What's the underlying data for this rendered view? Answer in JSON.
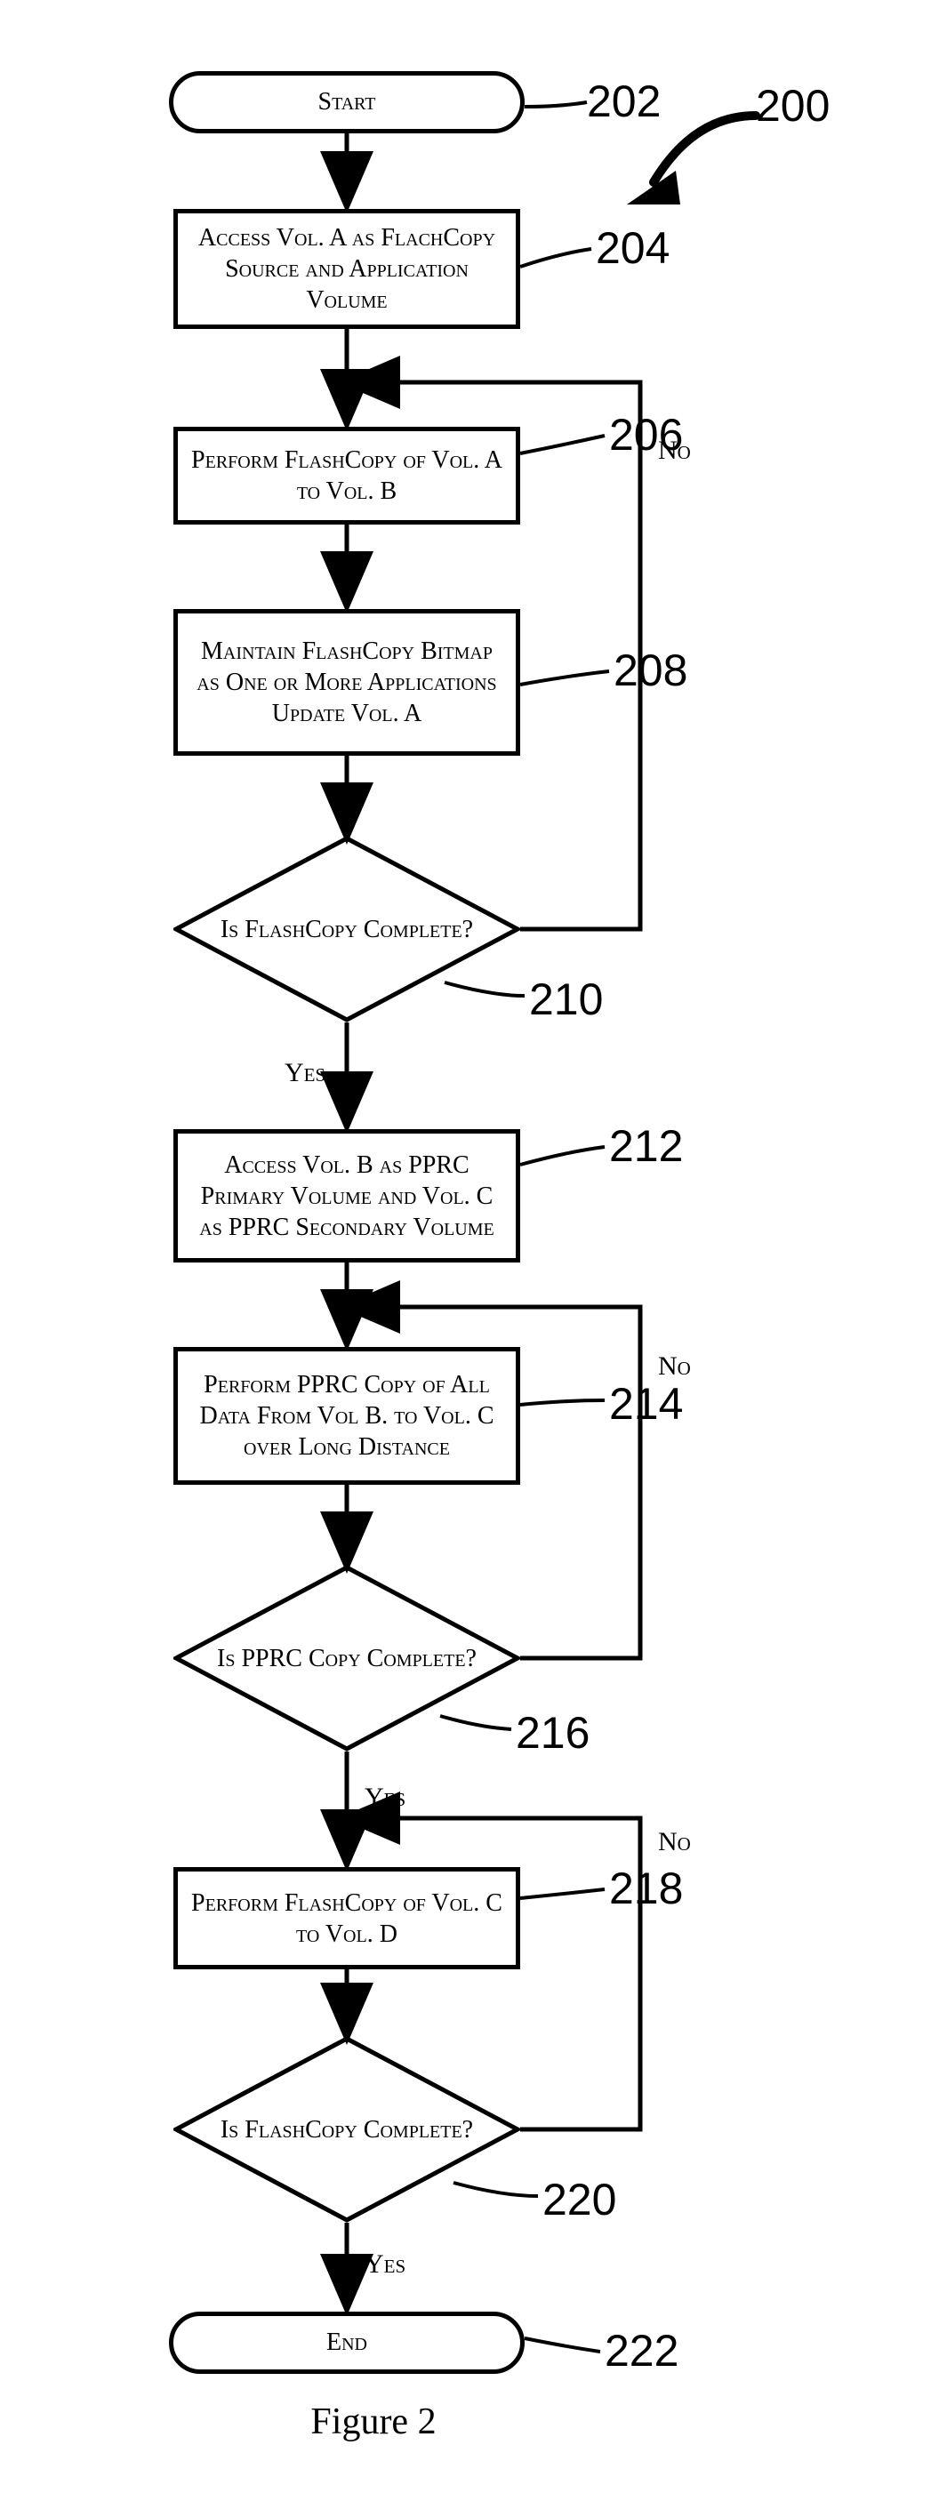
{
  "figure": {
    "caption": "Figure 2"
  },
  "callouts": {
    "c200": "200",
    "c202": "202",
    "c204": "204",
    "c206": "206",
    "c208": "208",
    "c210": "210",
    "c212": "212",
    "c214": "214",
    "c216": "216",
    "c218": "218",
    "c220": "220",
    "c222": "222"
  },
  "shapes": {
    "start": "Start",
    "s204": "Access Vol. A as FlachCopy Source and Application Volume",
    "s206": "Perform FlashCopy of Vol. A to Vol. B",
    "s208": "Maintain FlashCopy Bitmap as One or More Applications Update Vol. A",
    "d210": "Is FlashCopy Complete?",
    "s212": "Access Vol. B as PPRC Primary Volume and Vol. C as PPRC Secondary Volume",
    "s214": "Perform  PPRC Copy of All Data From Vol B. to Vol. C over Long Distance",
    "d216": "Is PPRC Copy Complete?",
    "s218": "Perform FlashCopy of Vol. C to Vol. D",
    "d220": "Is FlashCopy Complete?",
    "end": "End"
  },
  "edgeLabels": {
    "yes": "Yes",
    "no": "No"
  }
}
